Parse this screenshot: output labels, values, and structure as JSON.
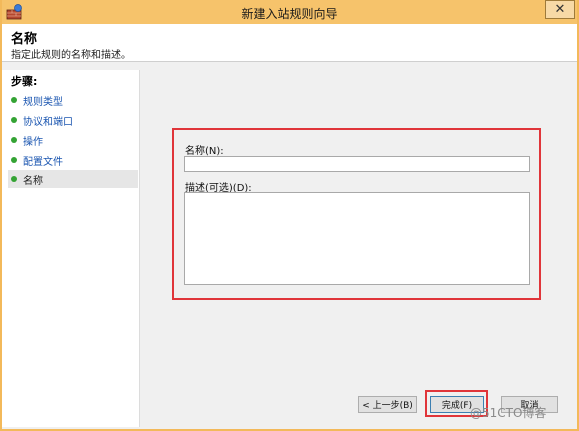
{
  "window": {
    "title": "新建入站规则向导",
    "close_symbol": "✕"
  },
  "header": {
    "title": "名称",
    "subtitle": "指定此规则的名称和描述。"
  },
  "steps": {
    "title": "步骤:",
    "items": [
      {
        "label": "规则类型"
      },
      {
        "label": "协议和端口"
      },
      {
        "label": "操作"
      },
      {
        "label": "配置文件"
      },
      {
        "label": "名称"
      }
    ]
  },
  "form": {
    "name_label": "名称(N):",
    "name_value": "",
    "desc_label": "描述(可选)(D):",
    "desc_value": ""
  },
  "buttons": {
    "back": "< 上一步(B)",
    "finish": "完成(F)",
    "cancel": "取消"
  },
  "watermark": "@51CTO博客",
  "colors": {
    "titlebar": "#f6c36b",
    "highlight": "#e0353a",
    "step_dot": "#34a334",
    "step_link": "#1a55b0"
  }
}
